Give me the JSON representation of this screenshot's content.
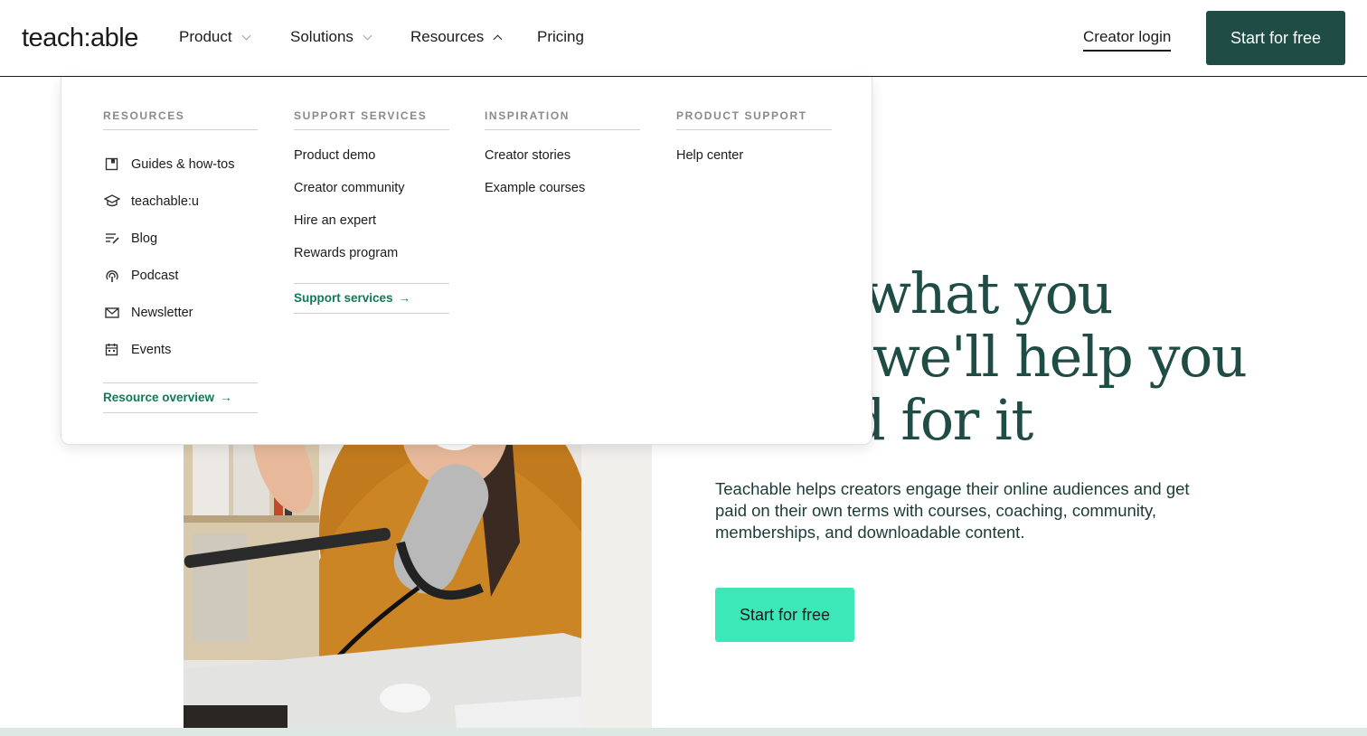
{
  "header": {
    "logo": "teach:able",
    "nav": [
      {
        "label": "Product",
        "chevron": "down"
      },
      {
        "label": "Solutions",
        "chevron": "down"
      },
      {
        "label": "Resources",
        "chevron": "up"
      },
      {
        "label": "Pricing"
      }
    ],
    "creator_login": "Creator login",
    "cta": "Start for free"
  },
  "dropdown": {
    "columns": [
      {
        "heading": "RESOURCES",
        "items": [
          {
            "label": "Guides & how-tos",
            "icon": "book-icon"
          },
          {
            "label": "teachable:u",
            "icon": "graduation-cap-icon"
          },
          {
            "label": "Blog",
            "icon": "edit-lines-icon"
          },
          {
            "label": "Podcast",
            "icon": "podcast-icon"
          },
          {
            "label": "Newsletter",
            "icon": "mail-icon"
          },
          {
            "label": "Events",
            "icon": "calendar-icon"
          }
        ],
        "link": "Resource overview"
      },
      {
        "heading": "SUPPORT SERVICES",
        "items": [
          "Product demo",
          "Creator community",
          "Hire an expert",
          "Rewards program"
        ],
        "link": "Support services"
      },
      {
        "heading": "INSPIRATION",
        "items": [
          "Creator stories",
          "Example courses"
        ]
      },
      {
        "heading": "PRODUCT SUPPORT",
        "items": [
          "Help center"
        ]
      }
    ]
  },
  "hero": {
    "title_lines": [
      "what you",
      "we'll help you",
      "d for it"
    ],
    "description": "Teachable helps creators engage their online audiences and get paid on their own terms with courses, coaching, community, memberships, and downloadable content.",
    "cta": "Start for free"
  },
  "colors": {
    "brand_dark": "#1f4d45",
    "brand_mint": "#3de8b8",
    "link_green": "#0f7a55"
  }
}
